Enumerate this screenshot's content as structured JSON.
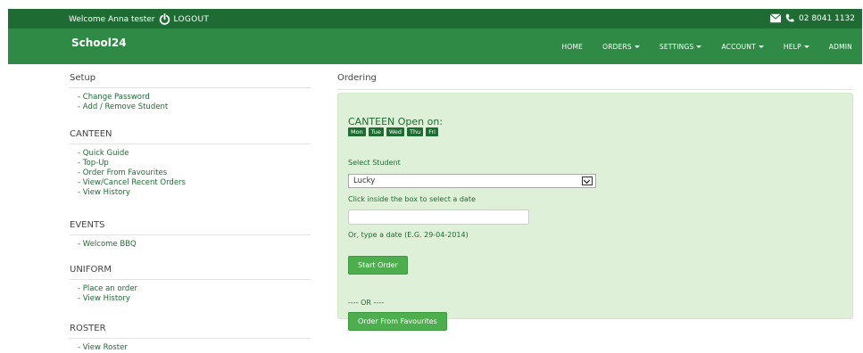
{
  "topbar": {
    "welcome": "Welcome Anna tester",
    "logout": "LOGOUT",
    "phone": "02 8041 1132",
    "icons": [
      "power-icon",
      "envelope-icon",
      "phone-icon"
    ]
  },
  "navbar": {
    "brand": "School24",
    "items": [
      {
        "label": "HOME",
        "dropdown": false
      },
      {
        "label": "ORDERS",
        "dropdown": true
      },
      {
        "label": "SETTINGS",
        "dropdown": true
      },
      {
        "label": "ACCOUNT",
        "dropdown": true
      },
      {
        "label": "HELP",
        "dropdown": true
      },
      {
        "label": "ADMIN",
        "dropdown": false
      }
    ]
  },
  "sidebar": {
    "setup": {
      "title": "Setup",
      "items": [
        "Change Password",
        "Add / Remove Student"
      ]
    },
    "canteen": {
      "title": "CANTEEN",
      "items": [
        "Quick Guide",
        "Top-Up",
        "Order From Favourites",
        "View/Cancel Recent Orders",
        "View History"
      ]
    },
    "events": {
      "title": "EVENTS",
      "items": [
        "Welcome BBQ"
      ]
    },
    "uniform": {
      "title": "UNIFORM",
      "items": [
        "Place an order",
        "View History"
      ]
    },
    "roster": {
      "title": "ROSTER",
      "items": [
        "View Roster"
      ]
    }
  },
  "main": {
    "heading": "Ordering",
    "open_title": "CANTEEN Open on:",
    "days": [
      "Mon",
      "Tue",
      "Wed",
      "Thu",
      "Fri"
    ],
    "select_label": "Select Student",
    "selected_student": "Lucky",
    "date_label": "Click inside the box to select a date",
    "type_label": "Or, type a date (E.G. 29-04-2014)",
    "start_button": "Start Order",
    "or_text": "---- OR ----",
    "favourites_button": "Order From Favourites"
  },
  "colors": {
    "dark_green": "#1e6b33",
    "nav_green": "#2f8a46",
    "panel_bg": "#dff0d8",
    "button_green": "#4cae4c"
  }
}
